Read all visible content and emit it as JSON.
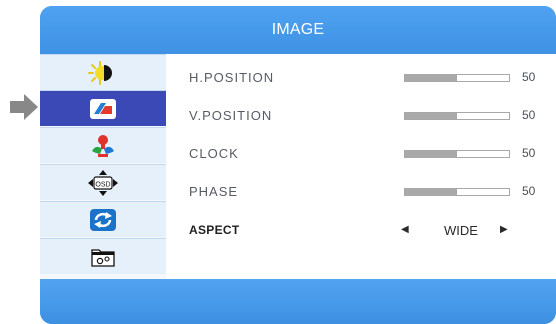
{
  "header": {
    "title": "IMAGE"
  },
  "menu": {
    "items": [
      {
        "icon": "brightness-contrast-icon"
      },
      {
        "icon": "image-icon",
        "selected": true
      },
      {
        "icon": "color-icon"
      },
      {
        "icon": "osd-icon"
      },
      {
        "icon": "reset-icon"
      },
      {
        "icon": "settings-folder-icon"
      }
    ]
  },
  "settings": {
    "h_position": {
      "label": "H.POSITION",
      "value": "50",
      "level": 0.5
    },
    "v_position": {
      "label": "V.POSITION",
      "value": "50",
      "level": 0.5
    },
    "clock": {
      "label": "CLOCK",
      "value": "50",
      "level": 0.5
    },
    "phase": {
      "label": "PHASE",
      "value": "50",
      "level": 0.5
    },
    "aspect": {
      "label": "ASPECT",
      "value": "WIDE"
    }
  },
  "colors": {
    "header_blue": "#4a9ae8",
    "selected_item": "#3a49b5",
    "pointer_gray": "#888888"
  }
}
